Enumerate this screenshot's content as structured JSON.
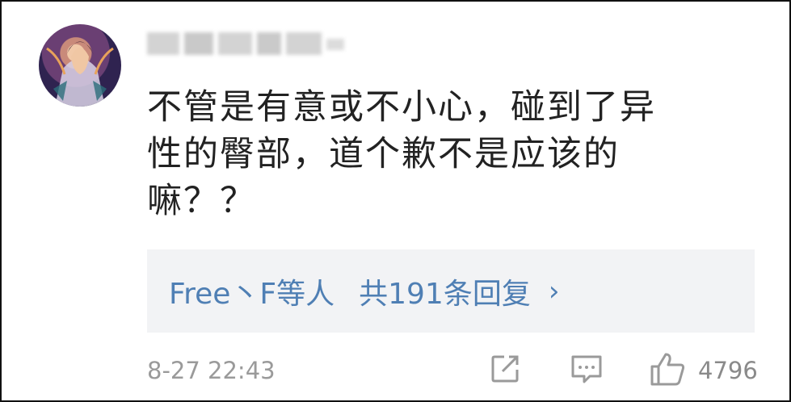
{
  "comment": {
    "text": "不管是有意或不小心，碰到了异\n性的臀部，道个歉不是应该的\n嘛？？",
    "replies": {
      "names": "Free丶F等人",
      "count_label": "共191条回复",
      "chevron": "›"
    },
    "timestamp": "8-27 22:43",
    "like_count": "4796"
  },
  "icons": {
    "share": "share-icon",
    "comment": "comment-icon",
    "like": "thumbs-up-icon"
  },
  "colors": {
    "link": "#4f7fb4",
    "meta": "#9a9a9a",
    "reply_bg": "#f2f3f5"
  }
}
